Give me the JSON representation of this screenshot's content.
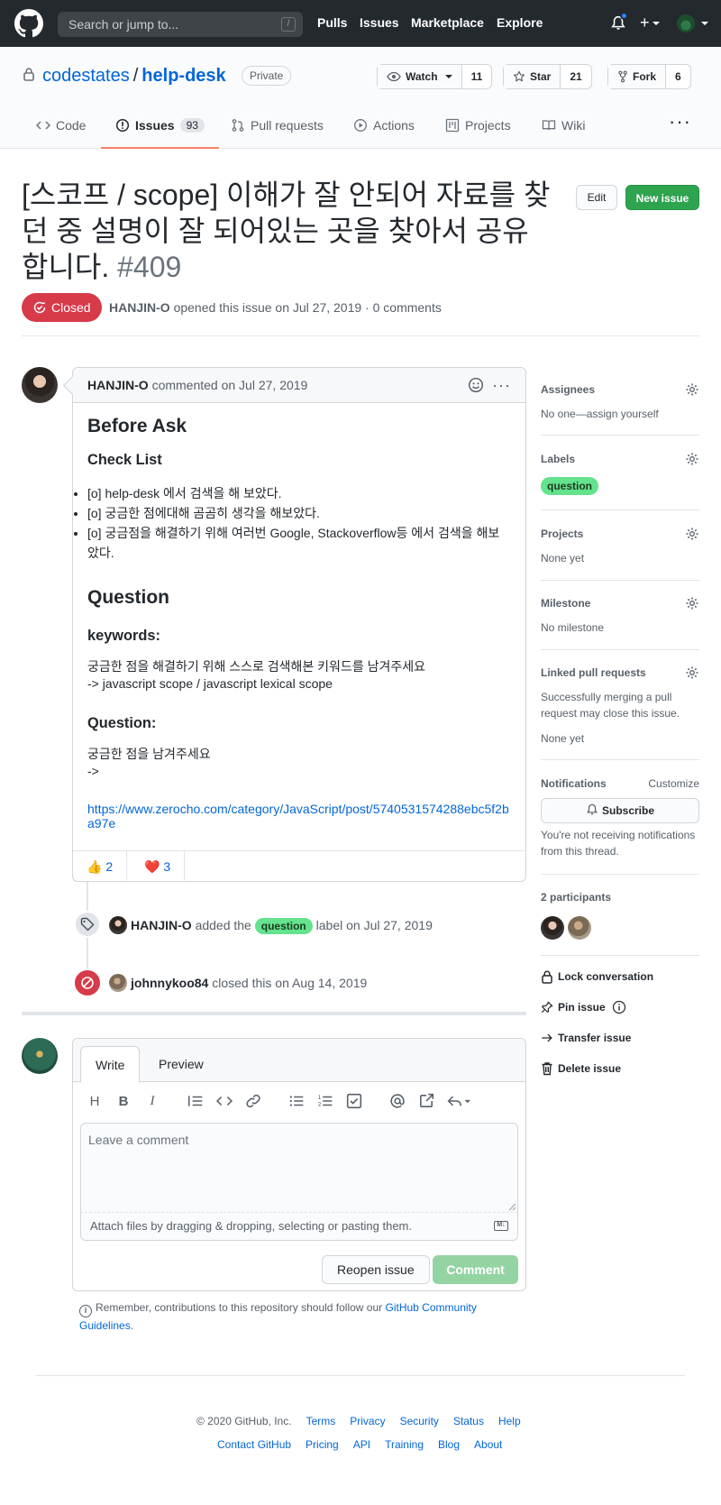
{
  "header": {
    "search_placeholder": "Search or jump to...",
    "search_shortcut": "/",
    "nav": [
      "Pulls",
      "Issues",
      "Marketplace",
      "Explore"
    ]
  },
  "repo": {
    "owner": "codestates",
    "separator": "/",
    "name": "help-desk",
    "visibility": "Private",
    "watch_label": "Watch",
    "watch_count": "11",
    "star_label": "Star",
    "star_count": "21",
    "fork_label": "Fork",
    "fork_count": "6"
  },
  "tabs": {
    "code": "Code",
    "issues": "Issues",
    "issues_count": "93",
    "pulls": "Pull requests",
    "actions": "Actions",
    "projects": "Projects",
    "wiki": "Wiki"
  },
  "issue": {
    "title": "[스코프 / scope] 이해가 잘 안되어 자료를 찾던 중 설명이 잘 되어있는 곳을 찾아서 공유합니다.",
    "number": "#409",
    "edit_label": "Edit",
    "new_issue_label": "New issue",
    "state": "Closed",
    "author": "HANJIN-O",
    "meta_text": "opened this issue on Jul 27, 2019 · 0 comments"
  },
  "comment": {
    "author": "HANJIN-O",
    "when": "commented on Jul 27, 2019",
    "h_before_ask": "Before Ask",
    "h_checklist": "Check List",
    "checklist": [
      "[o] help-desk 에서 검색을 해 보았다.",
      "[o] 궁금한 점에대해 곰곰히 생각을 해보았다.",
      "[o] 궁금점을 해결하기 위해 여러번 Google, Stackoverflow등 에서 검색을 해보았다."
    ],
    "h_question": "Question",
    "h_keywords": "keywords:",
    "keywords_line1": "궁금한 점을 해결하기 위해 스스로 검색해본 키워드를 남겨주세요",
    "keywords_line2": "-> javascript scope / javascript lexical scope",
    "h_question2": "Question:",
    "question_line1": "궁금한 점을 남겨주세요",
    "question_line2": "->",
    "link": "https://www.zerocho.com/category/JavaScript/post/5740531574288ebc5f2ba97e",
    "reactions": [
      {
        "emoji": "👍",
        "count": "2"
      },
      {
        "emoji": "❤️",
        "count": "3"
      }
    ]
  },
  "timeline": {
    "label_event": {
      "actor": "HANJIN-O",
      "pre": "added the",
      "label": "question",
      "post": "label on Jul 27, 2019"
    },
    "close_event": {
      "actor": "johnnykoo84",
      "text": "closed this on Aug 14, 2019"
    }
  },
  "form": {
    "tab_write": "Write",
    "tab_preview": "Preview",
    "placeholder": "Leave a comment",
    "attach_text": "Attach files by dragging & dropping, selecting or pasting them.",
    "reopen_label": "Reopen issue",
    "comment_label": "Comment",
    "contrib_text": "Remember, contributions to this repository should follow our",
    "contrib_link": "GitHub Community Guidelines",
    "contrib_end": "."
  },
  "sidebar": {
    "assignees_h": "Assignees",
    "assignees_t": "No one—assign yourself",
    "labels_h": "Labels",
    "label": "question",
    "projects_h": "Projects",
    "projects_t": "None yet",
    "milestone_h": "Milestone",
    "milestone_t": "No milestone",
    "linked_h": "Linked pull requests",
    "linked_t": "Successfully merging a pull request may close this issue.",
    "linked_none": "None yet",
    "notifications_h": "Notifications",
    "customize": "Customize",
    "subscribe": "Subscribe",
    "notif_t": "You're not receiving notifications from this thread.",
    "participants_h": "2 participants",
    "lock": "Lock conversation",
    "pin": "Pin issue",
    "transfer": "Transfer issue",
    "delete": "Delete issue"
  },
  "footer": {
    "copyright": "© 2020 GitHub, Inc.",
    "row1": [
      "Terms",
      "Privacy",
      "Security",
      "Status",
      "Help"
    ],
    "row2": [
      "Contact GitHub",
      "Pricing",
      "API",
      "Training",
      "Blog",
      "About"
    ]
  },
  "colors": {
    "header_bg": "#24292e",
    "closed_red": "#d73a49",
    "link_blue": "#0366d6",
    "green": "#2ea44f",
    "label_green": "#65e28d"
  }
}
